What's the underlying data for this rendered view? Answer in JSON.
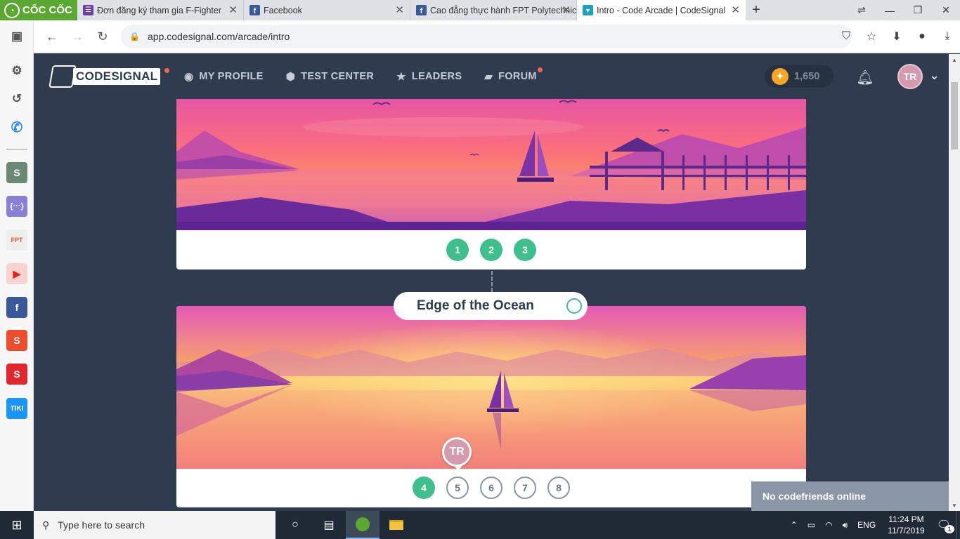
{
  "browser": {
    "brand": "CỐC CỐC",
    "tabs": [
      {
        "title": "Đơn đăng ký tham gia F-Fighter",
        "color": "#6b3fa0",
        "glyph": "☰",
        "active": false
      },
      {
        "title": "Facebook",
        "color": "#3b5998",
        "glyph": "f",
        "active": false
      },
      {
        "title": "Cao đẳng thực hành FPT Polytechnic",
        "color": "#3b5998",
        "glyph": "f",
        "active": false
      },
      {
        "title": "Intro - Code Arcade | CodeSignal",
        "color": "#1ca1c1",
        "glyph": "▼",
        "active": true
      }
    ],
    "url": "app.codesignal.com/arcade/intro"
  },
  "header": {
    "logo_text": "CODESIGNAL",
    "nav": [
      {
        "label": "MY PROFILE",
        "icon": "user-circle-icon",
        "glyph": "●"
      },
      {
        "label": "TEST CENTER",
        "icon": "shield-icon",
        "glyph": "⬢"
      },
      {
        "label": "LEADERS",
        "icon": "star-icon",
        "glyph": "★"
      },
      {
        "label": "FORUM",
        "icon": "chat-icon",
        "glyph": "▰"
      }
    ],
    "coins": "1,650",
    "avatar_initials": "TR"
  },
  "arcade": {
    "level1_steps": [
      "1",
      "2",
      "3"
    ],
    "level2_title": "Edge of the Ocean",
    "level2_steps": [
      "4",
      "5",
      "6",
      "7",
      "8"
    ],
    "pin_initials": "TR"
  },
  "friends_panel": "No codefriends online",
  "taskbar": {
    "search_placeholder": "Type here to search",
    "lang": "ENG",
    "time": "11:24 PM",
    "date": "11/7/2019",
    "notifications": "1"
  },
  "colors": {
    "accent_green": "#3fbf8e",
    "header_bg": "#2f3b4f"
  }
}
